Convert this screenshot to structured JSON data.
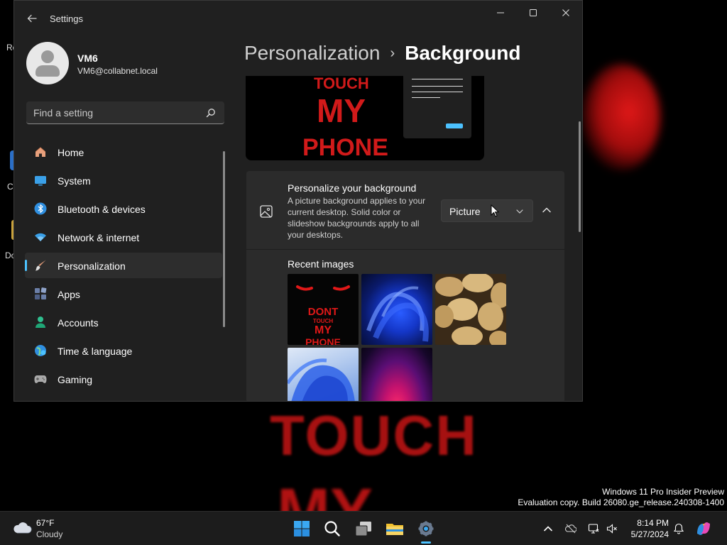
{
  "desktop": {
    "icon_labels": [
      "Re",
      "Cl",
      "Do"
    ],
    "wallpaper_text": [
      "TOUCH",
      "MY"
    ]
  },
  "watermark": {
    "line1": "Windows 11 Pro Insider Preview",
    "line2": "Evaluation copy. Build 26080.ge_release.240308-1400"
  },
  "window": {
    "title": "Settings",
    "controls": {
      "minimize": "—",
      "maximize": "☐",
      "close": "✕"
    }
  },
  "profile": {
    "name": "VM6",
    "email": "VM6@collabnet.local"
  },
  "search": {
    "placeholder": "Find a setting"
  },
  "sidebar": {
    "items": [
      {
        "label": "Home",
        "icon": "home-icon"
      },
      {
        "label": "System",
        "icon": "system-icon"
      },
      {
        "label": "Bluetooth & devices",
        "icon": "bluetooth-icon"
      },
      {
        "label": "Network & internet",
        "icon": "network-icon"
      },
      {
        "label": "Personalization",
        "icon": "brush-icon",
        "active": true
      },
      {
        "label": "Apps",
        "icon": "apps-icon"
      },
      {
        "label": "Accounts",
        "icon": "accounts-icon"
      },
      {
        "label": "Time & language",
        "icon": "globe-icon"
      },
      {
        "label": "Gaming",
        "icon": "gamepad-icon"
      }
    ]
  },
  "breadcrumb": {
    "parent": "Personalization",
    "separator": "›",
    "current": "Background"
  },
  "preview": {
    "line1": "TOUCH",
    "line2": "MY",
    "line3": "PHONE"
  },
  "background_card": {
    "title": "Personalize your background",
    "description": "A picture background applies to your current desktop. Solid color or slideshow backgrounds apply to all your desktops.",
    "dropdown_value": "Picture",
    "recent_images_label": "Recent images",
    "recent_images": [
      {
        "name": "dont-touch-my-phone",
        "text": [
          "DONT",
          "TOUCH",
          "MY",
          "PHONE"
        ]
      },
      {
        "name": "blue-bloom-dark"
      },
      {
        "name": "potatoes"
      },
      {
        "name": "blue-bloom-light"
      },
      {
        "name": "purple-glow"
      }
    ]
  },
  "taskbar": {
    "weather": {
      "temp": "67°F",
      "condition": "Cloudy"
    },
    "clock": {
      "time": "8:14 PM",
      "date": "5/27/2024"
    }
  },
  "colors": {
    "accent": "#4cc2ff",
    "window_bg": "#202020",
    "card_bg": "#2b2b2b",
    "taskbar_bg": "#1c1c1c",
    "wallpaper_red": "#c41414"
  }
}
